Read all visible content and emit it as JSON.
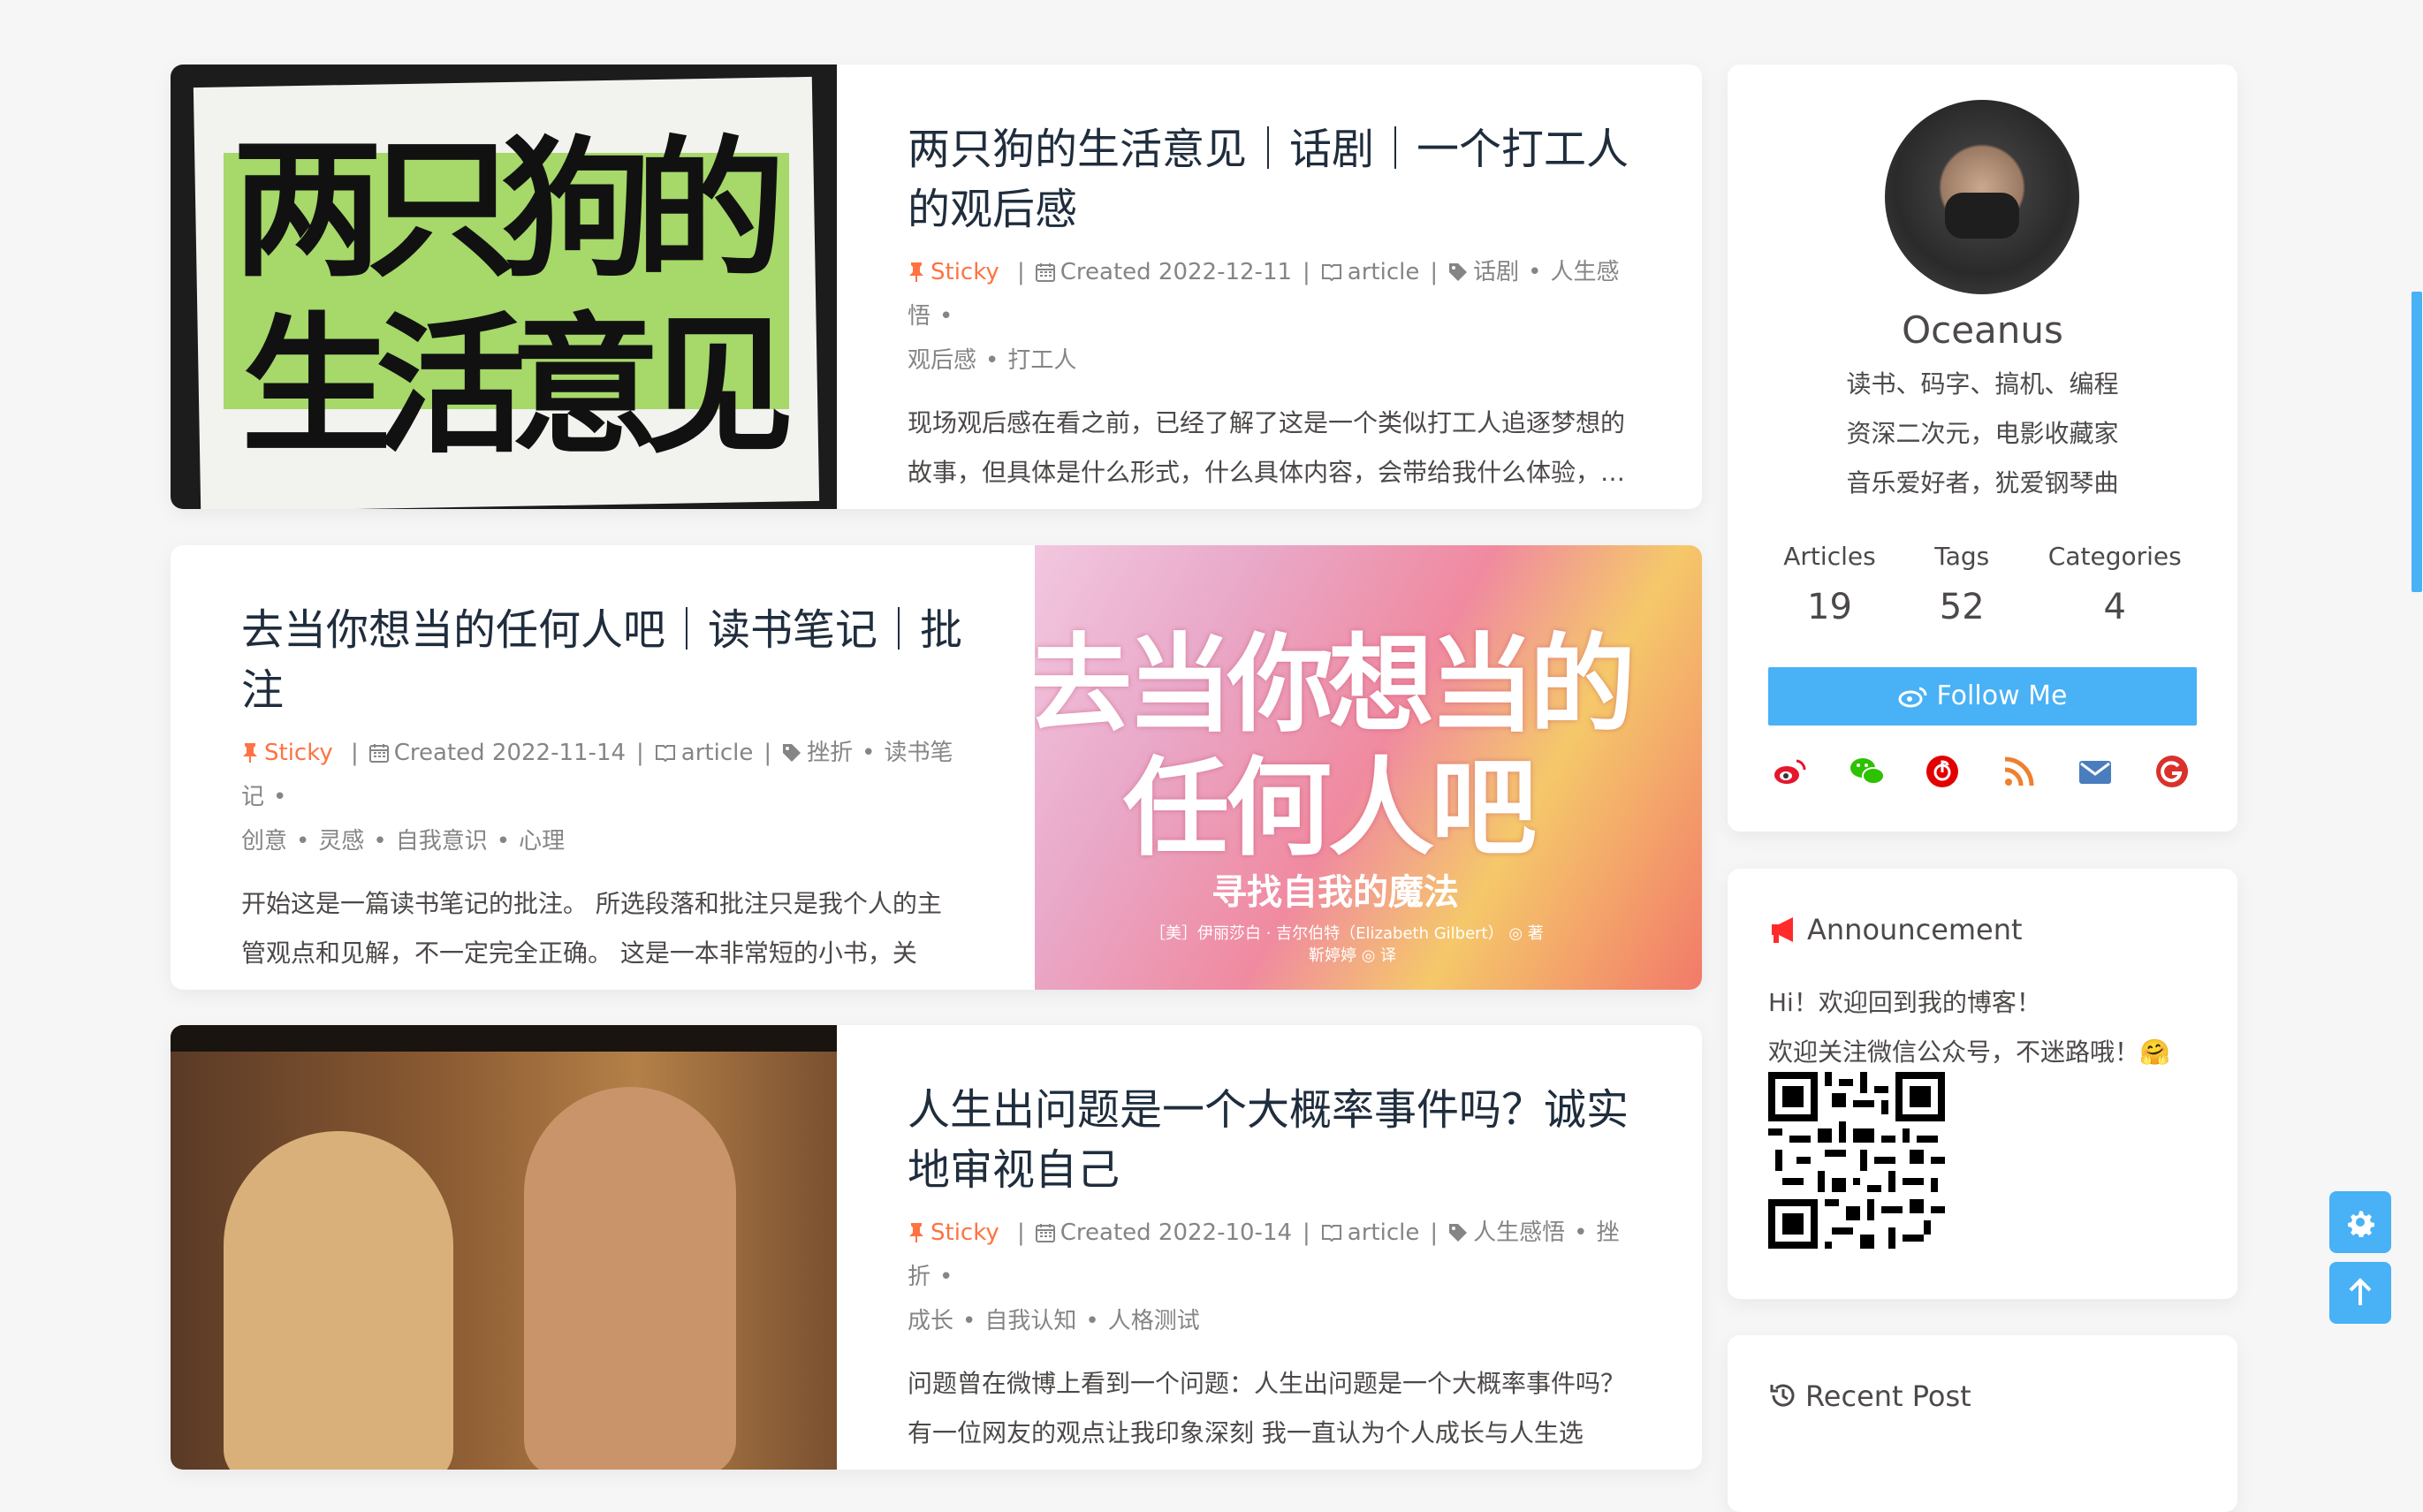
{
  "posts": [
    {
      "title": "两只狗的生活意见｜话剧｜一个打工人的观后感",
      "sticky": "Sticky",
      "created": "Created 2022-12-11",
      "category": "article",
      "tags_line1": [
        "话剧",
        "人生感悟"
      ],
      "tags_line2": [
        "观后感",
        "打工人"
      ],
      "excerpt": "现场观后感在看之前，已经了解了这是一个类似打工人追逐梦想的故事，但具体是什么形式，什么具体内容，会带给我什么体验，…",
      "cover_text1": "两只狗的",
      "cover_text2": "生活意见"
    },
    {
      "title": "去当你想当的任何人吧｜读书笔记｜批注",
      "sticky": "Sticky",
      "created": "Created 2022-11-14",
      "category": "article",
      "tags_line1": [
        "挫折",
        "读书笔记"
      ],
      "tags_line2": [
        "创意",
        "灵感",
        "自我意识",
        "心理"
      ],
      "excerpt": "开始这是一篇读书笔记的批注。 所选段落和批注只是我个人的主管观点和见解，不一定完全正确。 这是一本非常短的小书，关于…",
      "cover_text1": "去当你想当的",
      "cover_text2": "任何人吧",
      "cover_text3": "寻找自我的魔法",
      "cover_text4": "［美］伊丽莎白 · 吉尔伯特（Elizabeth Gilbert） ◎ 著",
      "cover_text5": "靳婷婷 ◎ 译"
    },
    {
      "title": "人生出问题是一个大概率事件吗？诚实地审视自己",
      "sticky": "Sticky",
      "created": "Created 2022-10-14",
      "category": "article",
      "tags_line1": [
        "人生感悟",
        "挫折"
      ],
      "tags_line2": [
        "成长",
        "自我认知",
        "人格测试"
      ],
      "excerpt": "问题曾在微博上看到一个问题：人生出问题是一个大概率事件吗？有一位网友的观点让我印象深刻 我一直认为个人成长与人生选择…"
    }
  ],
  "profile": {
    "name": "Oceanus",
    "bio": [
      "读书、码字、搞机、编程",
      "资深二次元，电影收藏家",
      "音乐爱好者，犹爱钢琴曲"
    ],
    "stats": [
      {
        "label": "Articles",
        "value": "19"
      },
      {
        "label": "Tags",
        "value": "52"
      },
      {
        "label": "Categories",
        "value": "4"
      }
    ],
    "follow_label": "Follow Me",
    "social_icons": [
      "weibo-icon",
      "wechat-icon",
      "netease-music-icon",
      "rss-icon",
      "email-icon",
      "google-icon"
    ]
  },
  "announcement": {
    "title": "Announcement",
    "line1": "Hi！欢迎回到我的博客！",
    "line2": "欢迎关注微信公众号，不迷路哦！🤗"
  },
  "recent": {
    "title": "Recent Post"
  },
  "colors": {
    "accent": "#49b1f5",
    "sticky": "#ff7242",
    "announcement": "#ff2a2a"
  }
}
